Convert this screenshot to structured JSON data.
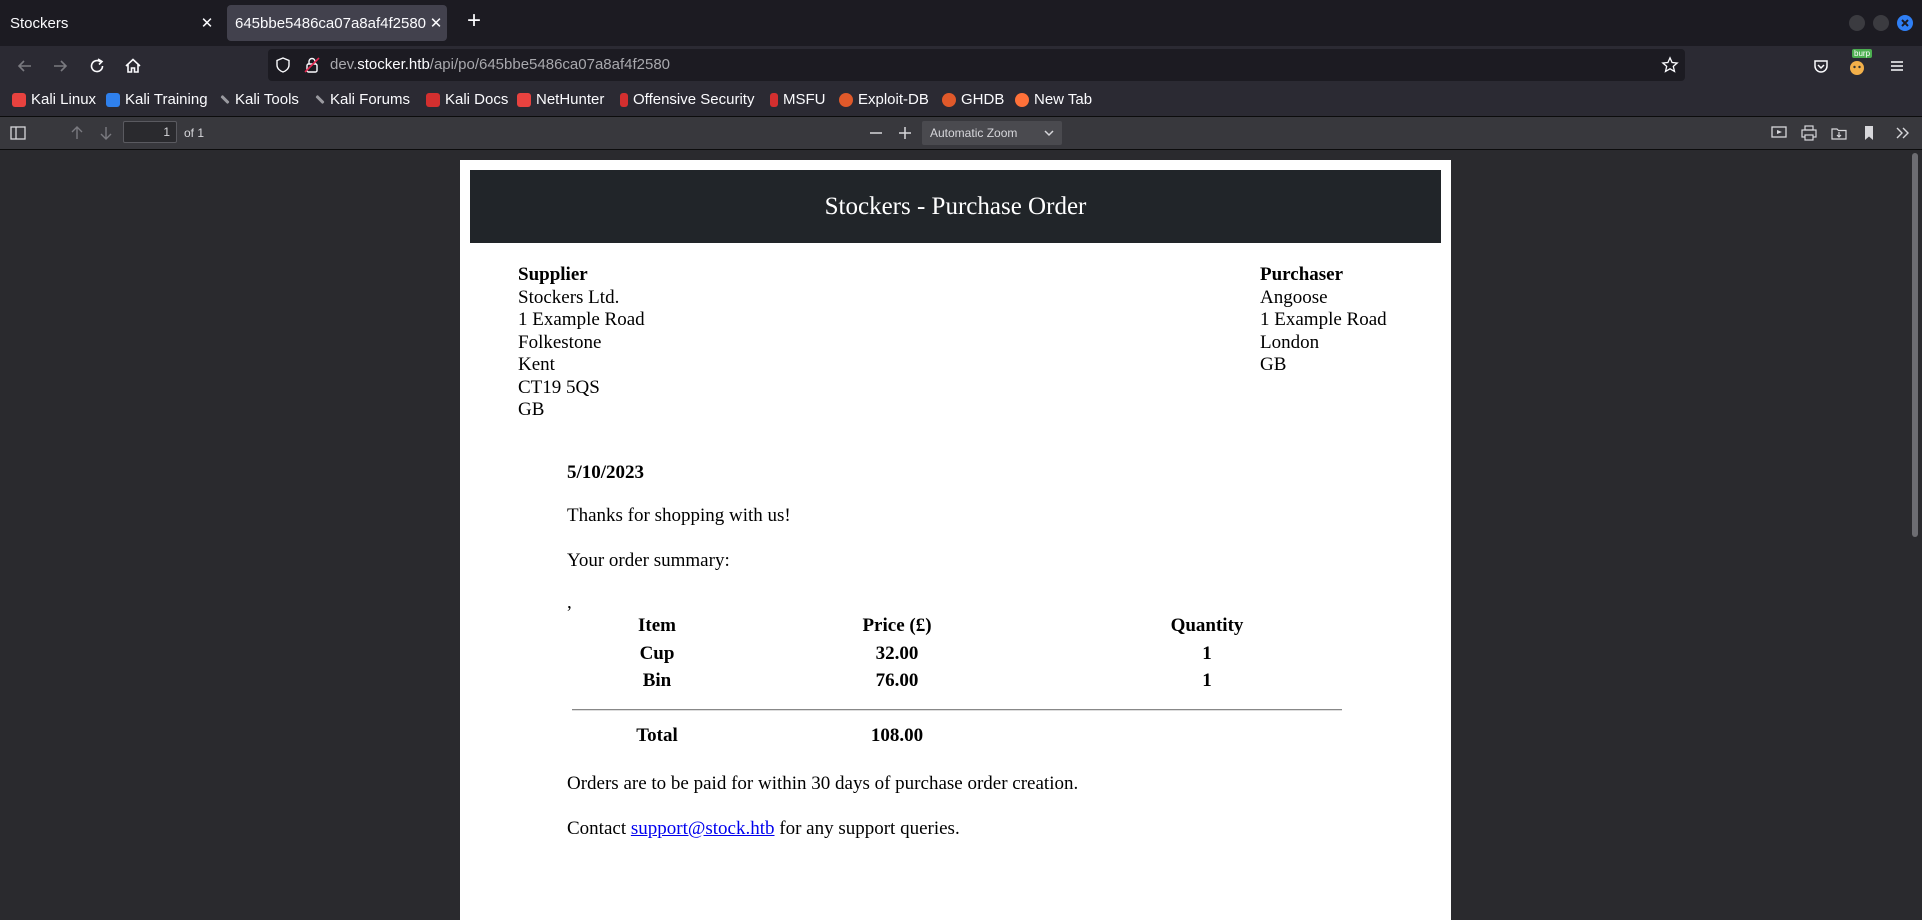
{
  "browser": {
    "tabs": [
      {
        "label": "Stockers"
      },
      {
        "label": "645bbe5486ca07a8af4f2580"
      }
    ],
    "url": {
      "prefix": "dev.",
      "domain": "stocker.htb",
      "path": "/api/po/645bbe5486ca07a8af4f2580"
    },
    "burp_badge": "burp",
    "bookmarks": [
      {
        "label": "Kali Linux",
        "color": "#e8423f"
      },
      {
        "label": "Kali Training",
        "color": "#2f80ed"
      },
      {
        "label": "Kali Tools",
        "color": "#9a9aa0"
      },
      {
        "label": "Kali Forums",
        "color": "#9a9aa0"
      },
      {
        "label": "Kali Docs",
        "color": "#d32f2f"
      },
      {
        "label": "NetHunter",
        "color": "#e8423f"
      },
      {
        "label": "Offensive Security",
        "color": "#d32f2f"
      },
      {
        "label": "MSFU",
        "color": "#d32f2f"
      },
      {
        "label": "Exploit-DB",
        "color": "#e0592a"
      },
      {
        "label": "GHDB",
        "color": "#e0592a"
      },
      {
        "label": "New Tab",
        "color": "#ff7139"
      }
    ]
  },
  "pdf_toolbar": {
    "page_number": "1",
    "page_count": "of 1",
    "zoom": "Automatic Zoom"
  },
  "document": {
    "title": "Stockers - Purchase Order",
    "supplier": {
      "heading": "Supplier",
      "lines": [
        "Stockers Ltd.",
        "1 Example Road",
        "Folkestone",
        "Kent",
        "CT19 5QS",
        "GB"
      ]
    },
    "purchaser": {
      "heading": "Purchaser",
      "lines": [
        "Angoose",
        "1 Example Road",
        "London",
        "GB"
      ]
    },
    "date": "5/10/2023",
    "thanks": "Thanks for shopping with us!",
    "summary_label": "Your order summary:",
    "stray_comma": ",",
    "table": {
      "headers": [
        "Item",
        "Price (£)",
        "Quantity"
      ],
      "rows": [
        [
          "Cup",
          "32.00",
          "1"
        ],
        [
          "Bin",
          "76.00",
          "1"
        ]
      ],
      "total_label": "Total",
      "total_value": "108.00"
    },
    "payment_note": "Orders are to be paid for within 30 days of purchase order creation.",
    "contact": {
      "before": "Contact",
      "email": "support@stock.htb",
      "after": "for any support queries."
    }
  }
}
